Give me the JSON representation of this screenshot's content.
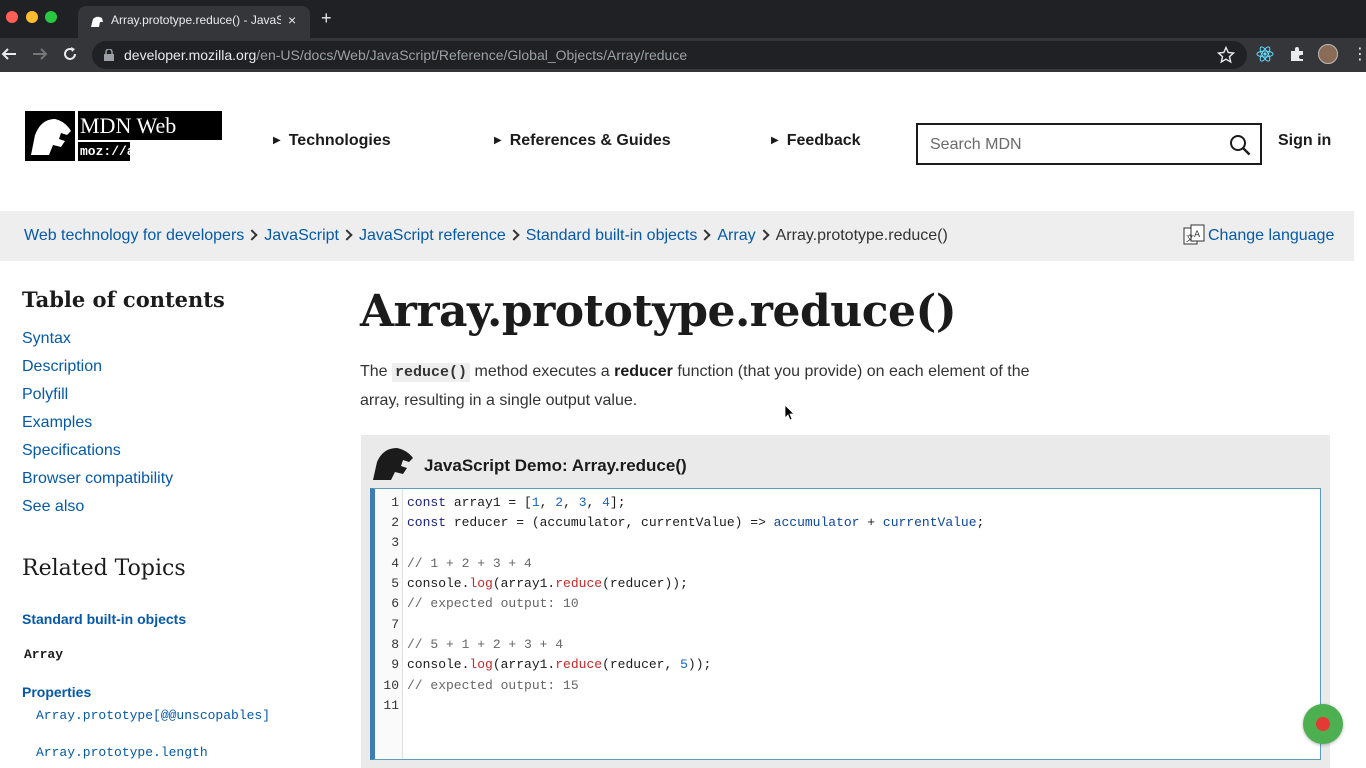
{
  "browser": {
    "tab_title": "Array.prototype.reduce() - JavaScript | MDN",
    "tab_close": "×",
    "new_tab": "+",
    "url_host": "developer.mozilla.org",
    "url_path": "/en-US/docs/Web/JavaScript/Reference/Global_Objects/Array/reduce",
    "kebab": "⋮"
  },
  "header": {
    "logo_text": "MDN Web Docs",
    "logo_moz": "moz://a",
    "nav": [
      "Technologies",
      "References & Guides",
      "Feedback"
    ],
    "search_placeholder": "Search MDN",
    "sign_in": "Sign in"
  },
  "breadcrumbs": {
    "items": [
      "Web technology for developers",
      "JavaScript",
      "JavaScript reference",
      "Standard built-in objects",
      "Array",
      "Array.prototype.reduce()"
    ],
    "change_language": "Change language"
  },
  "sidebar": {
    "toc_title": "Table of contents",
    "toc_items": [
      "Syntax",
      "Description",
      "Polyfill",
      "Examples",
      "Specifications",
      "Browser compatibility",
      "See also"
    ],
    "related_title": "Related Topics",
    "standard_objects": "Standard built-in objects",
    "array_link": "Array",
    "properties_label": "Properties",
    "properties": [
      "Array.prototype[@@unscopables]",
      "Array.prototype.length"
    ]
  },
  "article": {
    "title": "Array.prototype.reduce()",
    "intro_the": "The",
    "intro_code": "reduce()",
    "intro_mid": "method executes a",
    "intro_strong": "reducer",
    "intro_end": "function (that you provide) on each element of the array, resulting in a single output value."
  },
  "demo": {
    "title": "JavaScript Demo: Array.reduce()",
    "line_numbers": [
      "1",
      "2",
      "3",
      "4",
      "5",
      "6",
      "7",
      "8",
      "9",
      "10",
      "11"
    ],
    "lines": [
      "const array1 = [1, 2, 3, 4];",
      "const reducer = (accumulator, currentValue) => accumulator + currentValue;",
      "",
      "// 1 + 2 + 3 + 4",
      "console.log(array1.reduce(reducer));",
      "// expected output: 10",
      "",
      "// 5 + 1 + 2 + 3 + 4",
      "console.log(array1.reduce(reducer, 5));",
      "// expected output: 15",
      ""
    ]
  },
  "colors": {
    "link": "#0559a8",
    "breadcrumb_bg": "#eeeeee",
    "demo_bg": "#eaeaea",
    "editor_border": "#3d7eae",
    "chrome_dark": "#202124",
    "record_button": "#4caf50",
    "record_dot": "#e53935"
  }
}
